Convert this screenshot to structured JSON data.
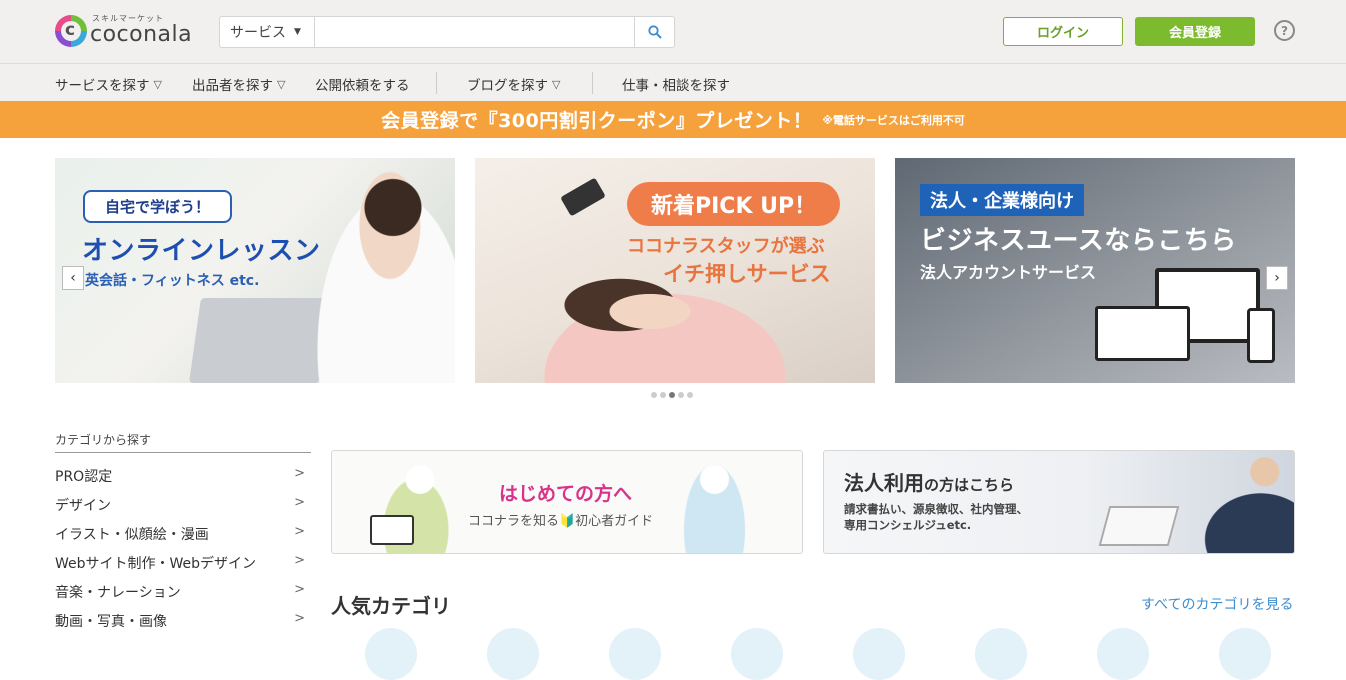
{
  "header": {
    "logo_sub": "スキルマーケット",
    "logo_main": "coconala",
    "search_category": "サービス",
    "search_placeholder": "",
    "login_label": "ログイン",
    "register_label": "会員登録",
    "help_label": "?"
  },
  "nav": {
    "items": [
      {
        "label": "サービスを探す"
      },
      {
        "label": "出品者を探す"
      },
      {
        "label": "公開依頼をする"
      },
      {
        "label": "ブログを探す"
      },
      {
        "label": "仕事・相談を探す"
      }
    ]
  },
  "promo": {
    "main": "会員登録で『300円割引クーポン』プレゼント！",
    "note": "※電話サービスはご利用不可"
  },
  "carousel": {
    "slide1": {
      "bubble": "自宅で学ぼう！",
      "title": "オンラインレッスン",
      "sub": "英会話・フィットネス etc."
    },
    "slide2": {
      "pill": "新着PICK UP！",
      "line1": "ココナラスタッフが選ぶ",
      "line2": "イチ押しサービス"
    },
    "slide3": {
      "tag": "法人・企業様向け",
      "title": "ビジネスユースならこちら",
      "sub": "法人アカウントサービス"
    },
    "dot_count": 5,
    "active_dot": 3
  },
  "sidebar": {
    "title": "カテゴリから探す",
    "items": [
      {
        "label": "PRO認定"
      },
      {
        "label": "デザイン"
      },
      {
        "label": "イラスト・似顔絵・漫画"
      },
      {
        "label": "Webサイト制作・Webデザイン"
      },
      {
        "label": "音楽・ナレーション"
      },
      {
        "label": "動画・写真・画像"
      }
    ]
  },
  "cards": {
    "beginner": {
      "title": "はじめての方へ",
      "sub": "ココナラを知る🔰初心者ガイド"
    },
    "corporate": {
      "title": "法人利用",
      "title_suffix": "の方はこちら",
      "desc1": "請求書払い、源泉徴収、社内管理、",
      "desc2": "専用コンシェルジュetc."
    }
  },
  "popular": {
    "title": "人気カテゴリ",
    "see_all": "すべてのカテゴリを見る"
  },
  "colors": {
    "accent_green": "#7cbb2e",
    "promo_orange": "#f6a23c",
    "link_blue": "#3d8ccd"
  }
}
